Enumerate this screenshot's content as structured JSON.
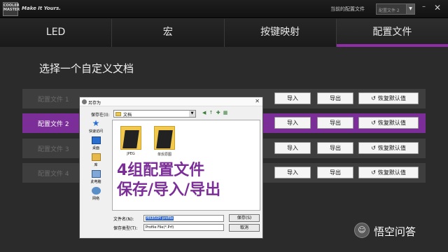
{
  "header": {
    "logo_text": "COOLER MASTER",
    "slogan": "Make It Yours.",
    "current_profile_label": "当前的配置文件",
    "current_profile_value": "配置文件 2",
    "minimize_icon": "minimize-icon",
    "close_icon": "close-icon"
  },
  "tabs": [
    {
      "label": "LED",
      "active": false
    },
    {
      "label": "宏",
      "active": false
    },
    {
      "label": "按键映射",
      "active": false
    },
    {
      "label": "配置文件",
      "active": true
    }
  ],
  "main": {
    "title": "选择一个自定义文档",
    "profiles": [
      {
        "name": "配置文件 1",
        "active": false
      },
      {
        "name": "配置文件 2",
        "active": true
      },
      {
        "name": "配置文件 3",
        "active": false
      },
      {
        "name": "配置文件 4",
        "active": false
      }
    ],
    "import_label": "导入",
    "export_label": "导出",
    "reset_label": "恢复默认值",
    "accent_color": "#7b2d98"
  },
  "dialog": {
    "title": "另存为",
    "save_in_label": "保存在(I):",
    "save_in_value": "文档",
    "places": [
      "快速访问",
      "桌面",
      "库",
      "此电脑",
      "网络"
    ],
    "files": [
      "JPEG",
      "单反原图"
    ],
    "overlay_line1": "4组配置文件",
    "overlay_line2": "保存/导入/导出",
    "filename_label": "文件名(N):",
    "filename_value": "MK850H profile",
    "filetype_label": "保存类型(T):",
    "filetype_value": "Profile File(*.Prf)",
    "save_button": "保存(S)",
    "cancel_button": "取消"
  },
  "watermark": {
    "text": "悟空问答"
  }
}
